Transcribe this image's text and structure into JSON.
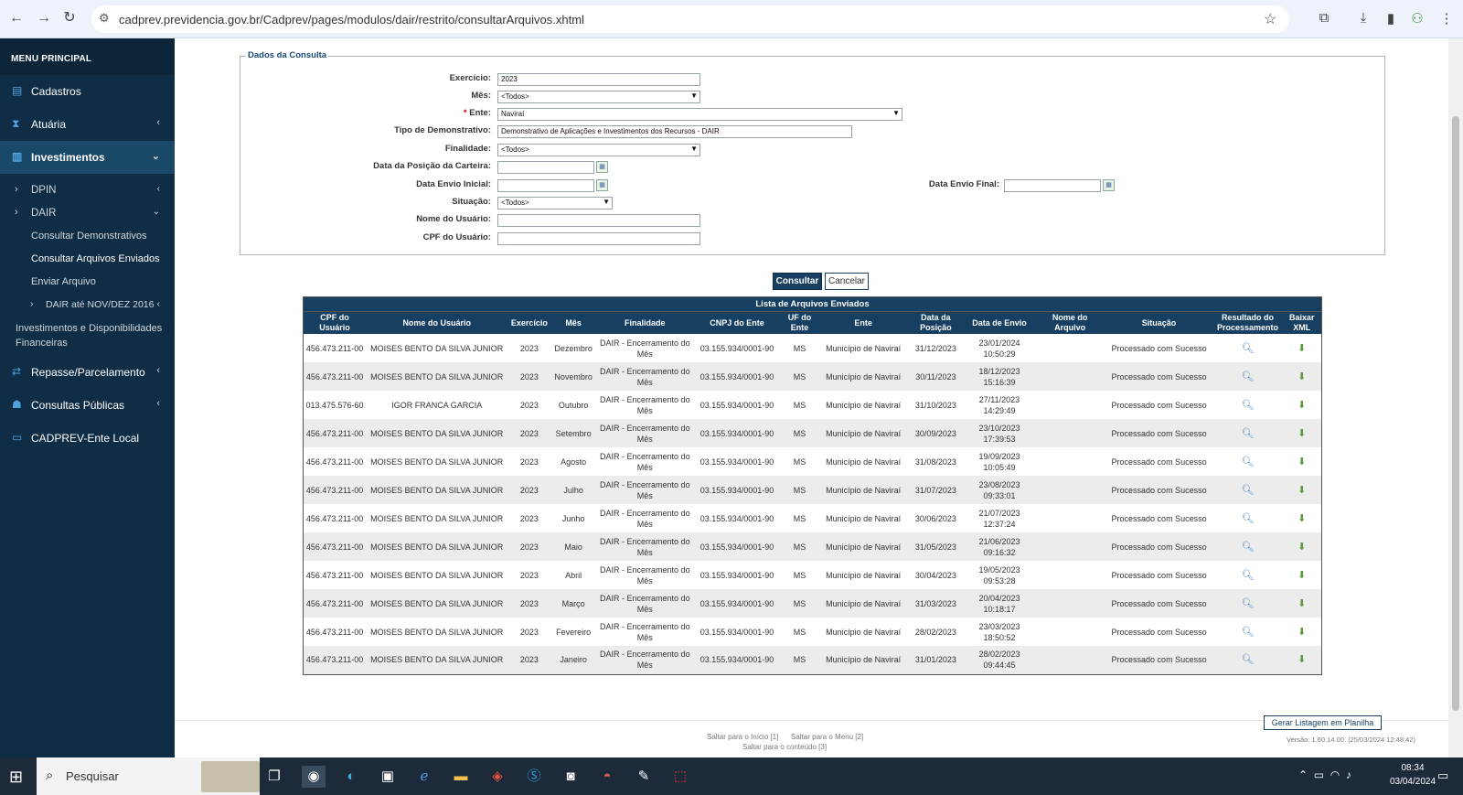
{
  "browser": {
    "url": "cadprev.previdencia.gov.br/Cadprev/pages/modulos/dair/restrito/consultarArquivos.xhtml"
  },
  "sidebar": {
    "title": "MENU PRINCIPAL",
    "items": [
      {
        "label": "Cadastros",
        "icon": "file-icon"
      },
      {
        "label": "Atuária",
        "icon": "hourglass-icon"
      },
      {
        "label": "Investimentos",
        "icon": "chart-icon"
      }
    ],
    "investimentos_sub": {
      "dpin": "DPIN",
      "dair": "DAIR",
      "dair_items": [
        "Consultar Demonstrativos",
        "Consultar Arquivos Enviados",
        "Enviar Arquivo"
      ],
      "dair_nov": "DAIR até NOV/DEZ 2016",
      "invest_disp": "Investimentos e Disponibilidades Financeiras"
    },
    "lower_items": [
      {
        "label": "Repasse/Parcelamento",
        "icon": "exchange-icon"
      },
      {
        "label": "Consultas Públicas",
        "icon": "users-icon"
      },
      {
        "label": "CADPREV-Ente Local",
        "icon": "monitor-icon"
      }
    ]
  },
  "form": {
    "legend": "Dados da Consulta",
    "exercicio_label": "Exercício:",
    "exercicio_value": "2023",
    "mes_label": "Mês:",
    "mes_value": "<Todos>",
    "ente_req": "*",
    "ente_label": "Ente:",
    "ente_value": "Naviraí",
    "tipo_label": "Tipo de Demonstrativo:",
    "tipo_value": "Demonstrativo de Aplicações e Investimentos dos Recursos - DAIR",
    "finalidade_label": "Finalidade:",
    "finalidade_value": "<Todos>",
    "data_posicao_label": "Data da Posição da Carteira:",
    "data_envio_inicial_label": "Data Envio Inicial:",
    "data_envio_final_label": "Data Envio Final:",
    "situacao_label": "Situação:",
    "situacao_value": "<Todos>",
    "nome_usuario_label": "Nome do Usuário:",
    "cpf_usuario_label": "CPF do Usuário:",
    "consultar": "Consultar",
    "cancelar": "Cancelar"
  },
  "table": {
    "caption": "Lista de Arquivos Enviados",
    "headers": [
      "CPF do Usuário",
      "Nome do Usuário",
      "Exercício",
      "Mês",
      "Finalidade",
      "CNPJ do Ente",
      "UF do Ente",
      "Ente",
      "Data da Posição",
      "Data de Envio",
      "Nome do Arquivo",
      "Situação",
      "Resultado do Processamento",
      "Baixar XML"
    ],
    "rows": [
      [
        "456.473.211-00",
        "MOISES BENTO DA SILVA JUNIOR",
        "2023",
        "Dezembro",
        "DAIR - Encerramento do Mês",
        "03.155.934/0001-90",
        "MS",
        "Município de Naviraí",
        "31/12/2023",
        "23/01/2024 10:50:29",
        "",
        "Processado com Sucesso"
      ],
      [
        "456.473.211-00",
        "MOISES BENTO DA SILVA JUNIOR",
        "2023",
        "Novembro",
        "DAIR - Encerramento do Mês",
        "03.155.934/0001-90",
        "MS",
        "Município de Naviraí",
        "30/11/2023",
        "18/12/2023 15:16:39",
        "",
        "Processado com Sucesso"
      ],
      [
        "013.475.576-60",
        "IGOR FRANCA GARCIA",
        "2023",
        "Outubro",
        "DAIR - Encerramento do Mês",
        "03.155.934/0001-90",
        "MS",
        "Município de Naviraí",
        "31/10/2023",
        "27/11/2023 14:29:49",
        "",
        "Processado com Sucesso"
      ],
      [
        "456.473.211-00",
        "MOISES BENTO DA SILVA JUNIOR",
        "2023",
        "Setembro",
        "DAIR - Encerramento do Mês",
        "03.155.934/0001-90",
        "MS",
        "Município de Naviraí",
        "30/09/2023",
        "23/10/2023 17:39:53",
        "",
        "Processado com Sucesso"
      ],
      [
        "456.473.211-00",
        "MOISES BENTO DA SILVA JUNIOR",
        "2023",
        "Agosto",
        "DAIR - Encerramento do Mês",
        "03.155.934/0001-90",
        "MS",
        "Município de Naviraí",
        "31/08/2023",
        "19/09/2023 10:05:49",
        "",
        "Processado com Sucesso"
      ],
      [
        "456.473.211-00",
        "MOISES BENTO DA SILVA JUNIOR",
        "2023",
        "Julho",
        "DAIR - Encerramento do Mês",
        "03.155.934/0001-90",
        "MS",
        "Município de Naviraí",
        "31/07/2023",
        "23/08/2023 09:33:01",
        "",
        "Processado com Sucesso"
      ],
      [
        "456.473.211-00",
        "MOISES BENTO DA SILVA JUNIOR",
        "2023",
        "Junho",
        "DAIR - Encerramento do Mês",
        "03.155.934/0001-90",
        "MS",
        "Município de Naviraí",
        "30/06/2023",
        "21/07/2023 12:37:24",
        "",
        "Processado com Sucesso"
      ],
      [
        "456.473.211-00",
        "MOISES BENTO DA SILVA JUNIOR",
        "2023",
        "Maio",
        "DAIR - Encerramento do Mês",
        "03.155.934/0001-90",
        "MS",
        "Município de Naviraí",
        "31/05/2023",
        "21/06/2023 09:16:32",
        "",
        "Processado com Sucesso"
      ],
      [
        "456.473.211-00",
        "MOISES BENTO DA SILVA JUNIOR",
        "2023",
        "Abril",
        "DAIR - Encerramento do Mês",
        "03.155.934/0001-90",
        "MS",
        "Município de Naviraí",
        "30/04/2023",
        "19/05/2023 09:53:28",
        "",
        "Processado com Sucesso"
      ],
      [
        "456.473.211-00",
        "MOISES BENTO DA SILVA JUNIOR",
        "2023",
        "Março",
        "DAIR - Encerramento do Mês",
        "03.155.934/0001-90",
        "MS",
        "Município de Naviraí",
        "31/03/2023",
        "20/04/2023 10:18:17",
        "",
        "Processado com Sucesso"
      ],
      [
        "456.473.211-00",
        "MOISES BENTO DA SILVA JUNIOR",
        "2023",
        "Fevereiro",
        "DAIR - Encerramento do Mês",
        "03.155.934/0001-90",
        "MS",
        "Município de Naviraí",
        "28/02/2023",
        "23/03/2023 18:50:52",
        "",
        "Processado com Sucesso"
      ],
      [
        "456.473.211-00",
        "MOISES BENTO DA SILVA JUNIOR",
        "2023",
        "Janeiro",
        "DAIR - Encerramento do Mês",
        "03.155.934/0001-90",
        "MS",
        "Município de Naviraí",
        "31/01/2023",
        "28/02/2023 09:44:45",
        "",
        "Processado com Sucesso"
      ]
    ]
  },
  "footer": {
    "gerar": "Gerar Listagem em Planilha",
    "link_inicio": "Saltar para o Início [1]",
    "link_menu": "Saltar para o Menu [2]",
    "link_conteudo": "Saltar para o conteúdo [3]",
    "version": "Versão: 1.60.14.00. (25/03/2024 12:48:42)"
  },
  "taskbar": {
    "search": "Pesquisar",
    "time": "08:34",
    "date": "03/04/2024"
  },
  "colors": {
    "sidebar_bg": "#0f2d45",
    "header_bg": "#163f62",
    "accent": "#4fa3e0"
  }
}
